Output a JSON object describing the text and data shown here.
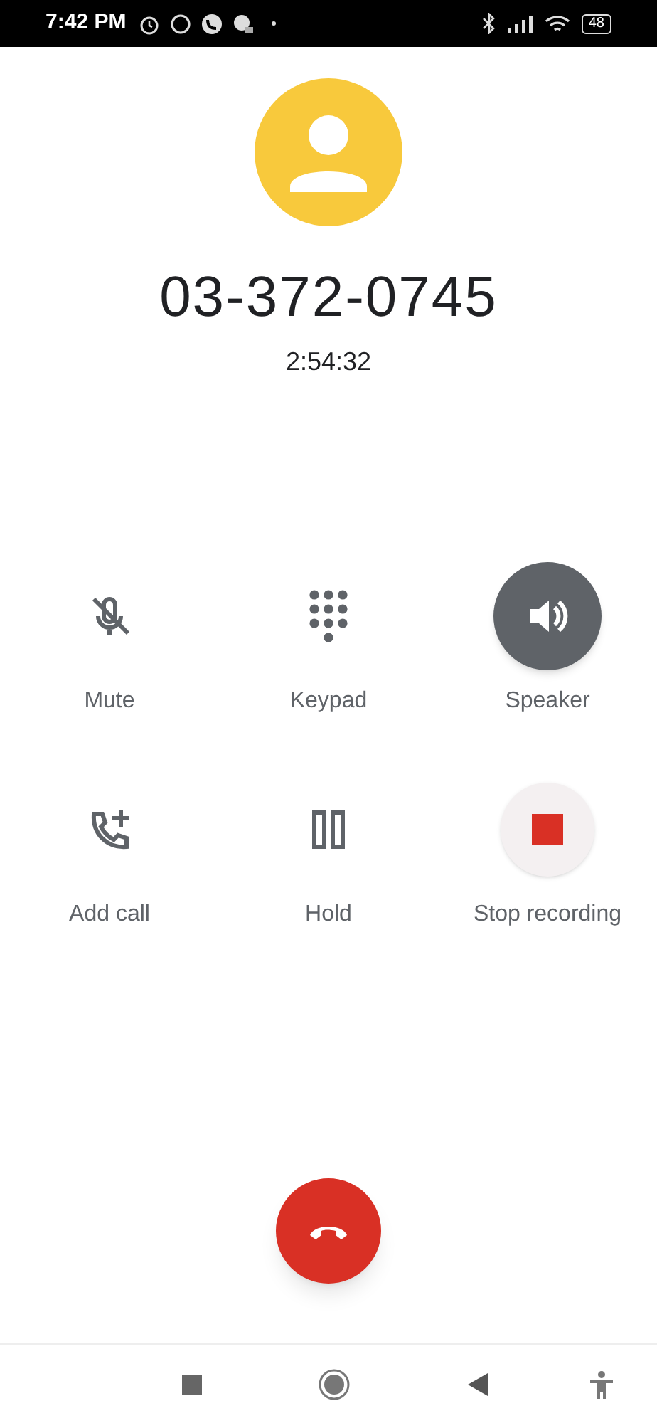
{
  "status_bar": {
    "time": "7:42 PM",
    "battery": "48"
  },
  "call": {
    "number": "03-372-0745",
    "duration": "2:54:32"
  },
  "controls": [
    {
      "kind": "mute",
      "label": "Mute",
      "on": false
    },
    {
      "kind": "keypad",
      "label": "Keypad",
      "on": false
    },
    {
      "kind": "speaker",
      "label": "Speaker",
      "on": true
    },
    {
      "kind": "addcall",
      "label": "Add call",
      "on": false
    },
    {
      "kind": "hold",
      "label": "Hold",
      "on": false
    },
    {
      "kind": "record",
      "label": "Stop recording",
      "on": false
    }
  ]
}
